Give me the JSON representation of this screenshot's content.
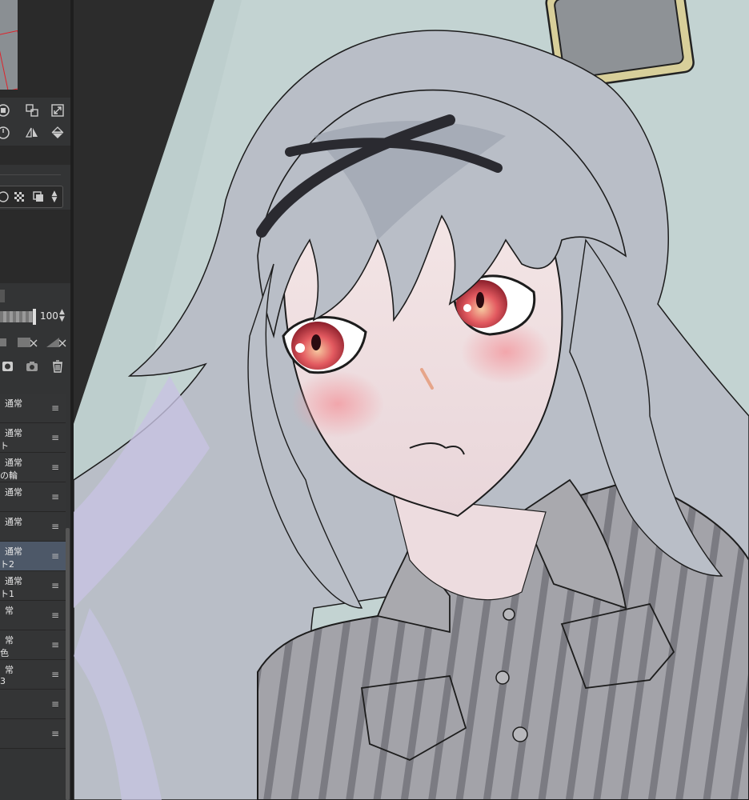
{
  "panel": {
    "opacity_value": "100",
    "layers": [
      {
        "mode": "通常",
        "name": ""
      },
      {
        "mode": "通常",
        "name": "ト"
      },
      {
        "mode": "通常",
        "name": "の輪"
      },
      {
        "mode": "通常",
        "name": ""
      },
      {
        "mode": "通常",
        "name": ""
      },
      {
        "mode": "通常",
        "name": "ト2"
      },
      {
        "mode": "通常",
        "name": "ト1"
      },
      {
        "mode": "常",
        "name": ""
      },
      {
        "mode": "常",
        "name": "色"
      },
      {
        "mode": "常",
        "name": "3"
      },
      {
        "mode": "",
        "name": ""
      },
      {
        "mode": "",
        "name": ""
      }
    ],
    "selected_layer_index": 5
  },
  "colors": {
    "panel_bg": "#333435",
    "selected_layer": "#4d5868",
    "canvas_bg": "#c3d3d2",
    "hair": "#b7bcc4",
    "shirt": "#9a9aa0",
    "skin": "#f3e3e3",
    "eye": "#e0424a"
  },
  "icons": [
    "record-icon",
    "transform-icon",
    "expand-icon",
    "rotate-reset-icon",
    "flip-horizontal-icon",
    "flip-vertical-icon",
    "circle-icon",
    "checker-icon",
    "copy-icon",
    "spinner-icon",
    "mask-icon",
    "camera-icon",
    "trash-icon",
    "hamburger-icon"
  ]
}
